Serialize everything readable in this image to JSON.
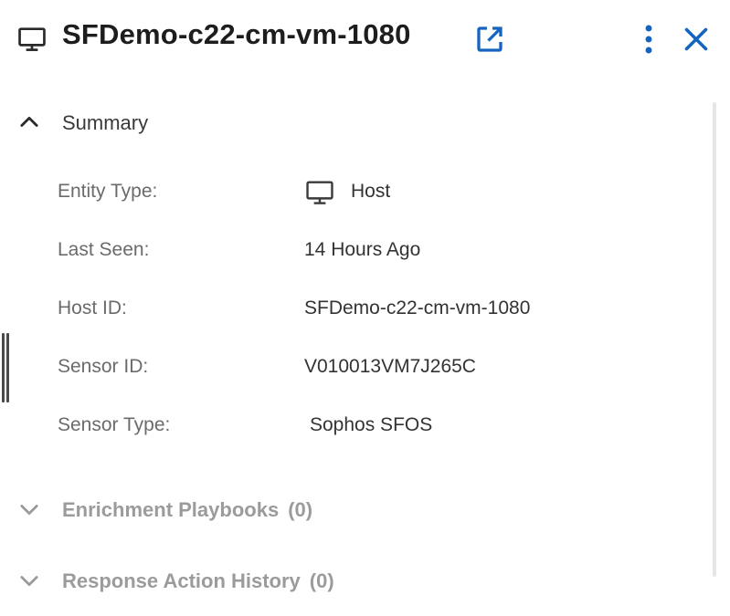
{
  "header": {
    "title": "SFDemo-c22-cm-vm-1080",
    "title_icon": "monitor-icon",
    "open_icon": "open-in-new-icon",
    "more_icon": "more-vertical-icon",
    "close_icon": "close-icon"
  },
  "colors": {
    "accent": "#1565c0",
    "title_text": "#1d1d1d",
    "label_text": "#6b6b6b",
    "value_text": "#333333",
    "collapsed_text": "#9b9b9b"
  },
  "summary": {
    "label": "Summary",
    "expanded": true,
    "rows": [
      {
        "label": "Entity Type:",
        "value": "Host",
        "icon": "monitor-icon"
      },
      {
        "label": "Last Seen:",
        "value": "14 Hours Ago"
      },
      {
        "label": "Host ID:",
        "value": "SFDemo-c22-cm-vm-1080"
      },
      {
        "label": "Sensor ID:",
        "value": "V010013VM7J265C"
      },
      {
        "label": "Sensor Type:",
        "value": "Sophos SFOS"
      }
    ]
  },
  "enrichment": {
    "label": "Enrichment Playbooks",
    "count": "(0)"
  },
  "response": {
    "label": "Response Action History",
    "count": "(0)"
  }
}
